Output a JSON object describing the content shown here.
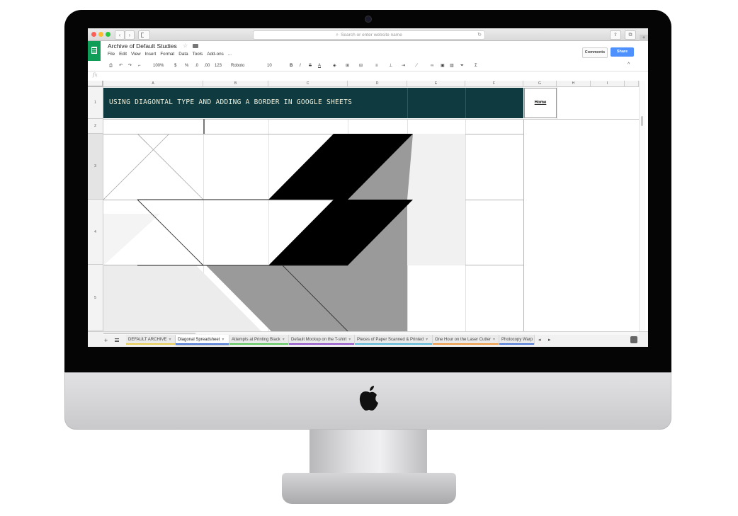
{
  "browser": {
    "address_placeholder": "Search or enter website name",
    "back_glyph": "‹",
    "forward_glyph": "›",
    "reload_glyph": "↻",
    "share_glyph": "⇪",
    "tabs_glyph": "⧉",
    "plus_glyph": "+"
  },
  "doc": {
    "title": "Archive of Default Studies",
    "star_glyph": "☆",
    "menu": [
      "File",
      "Edit",
      "View",
      "Insert",
      "Format",
      "Data",
      "Tools",
      "Add-ons",
      "..."
    ],
    "comments_label": "Comments",
    "share_label": "Share"
  },
  "toolbar": {
    "zoom": "100%",
    "currency": "$",
    "percent": "%",
    "decrease_decimals": ".0",
    "increase_decimals": ".00",
    "more_formats": "123",
    "font": "Roboto",
    "font_size": "10",
    "bold": "B",
    "italic": "I",
    "strike": "S",
    "text_color": "A",
    "functions": "Σ",
    "collapse": "^"
  },
  "formula": {
    "fx": "fx"
  },
  "grid": {
    "columns": [
      "A",
      "B",
      "C",
      "D",
      "E",
      "F",
      "G",
      "H",
      "I"
    ],
    "rows": [
      "1",
      "2",
      "3",
      "4",
      "5"
    ],
    "banner_title": "USING DIAGONTAL TYPE AND ADDING A BORDER IN GOOGLE SHEETS",
    "home_link": "Home"
  },
  "tabs": {
    "add_glyph": "+",
    "prev_glyph": "◂",
    "next_glyph": "▸",
    "caret": "▾",
    "sheets": [
      {
        "label": "DEFAULT ARCHIVE",
        "color": "#e8cc50",
        "active": false
      },
      {
        "label": "Diagonal Spreadsheet",
        "color": "#4a78d8",
        "active": true
      },
      {
        "label": "Attempts at Printing Black",
        "color": "#5cc85c",
        "active": false
      },
      {
        "label": "Default Mockup on the T-shirt",
        "color": "#9050c8",
        "active": false
      },
      {
        "label": "Pieces of Paper Scanned & Printed",
        "color": "#58b8d8",
        "active": false
      },
      {
        "label": "One Hour on the Laser Cutter",
        "color": "#f09840",
        "active": false
      },
      {
        "label": "Photocopy Warp",
        "color": "#4a78d8",
        "active": false
      }
    ]
  },
  "colors": {
    "banner_bg": "#0e3a40",
    "banner_text": "#f2eed8",
    "sheets_green": "#0f9d58",
    "share_blue": "#4d90fe"
  }
}
